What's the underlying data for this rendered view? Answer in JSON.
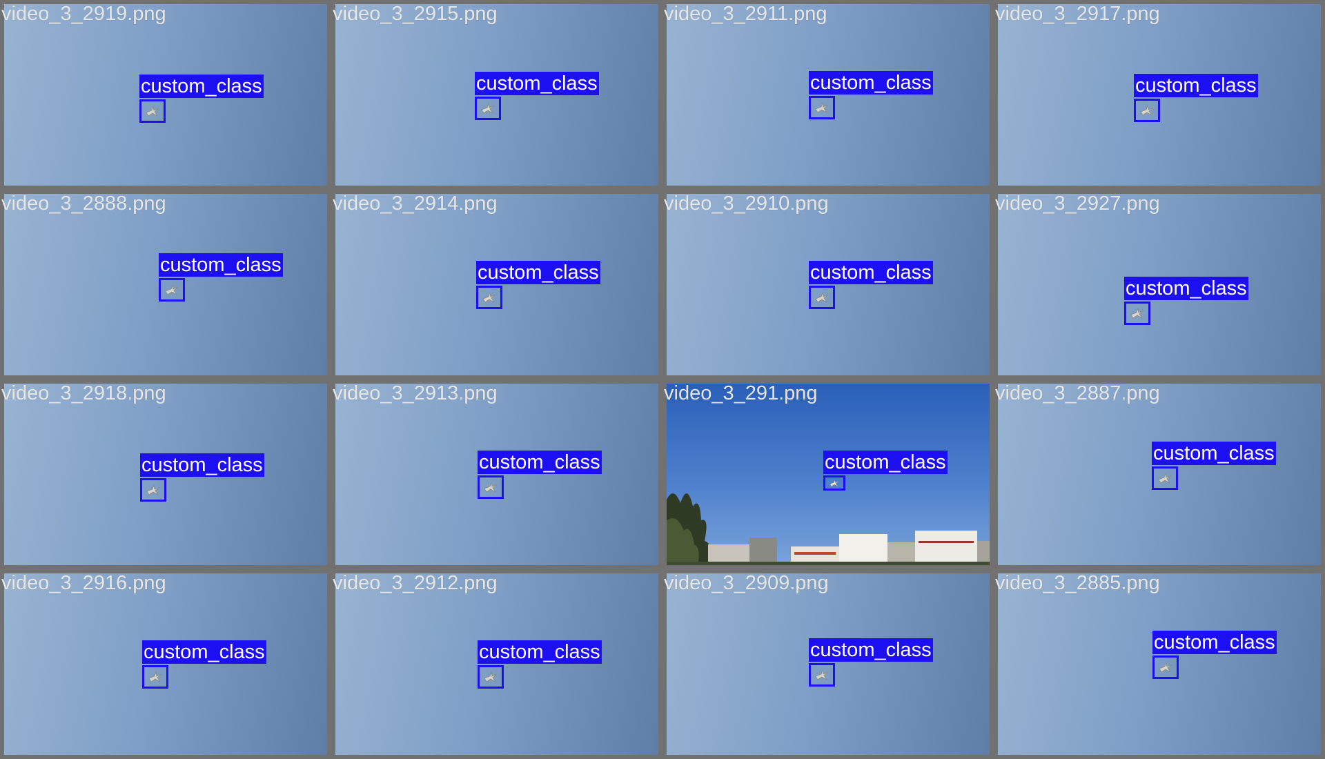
{
  "colors": {
    "tile_border": "#717171",
    "label_background": "#1c0ff2",
    "bbox_border": "#1c0ff2",
    "filename_text": "#e6e6e6",
    "label_text": "#ffffff"
  },
  "tiles": [
    {
      "filename": "video_3_2919.png",
      "label": "custom_class"
    },
    {
      "filename": "video_3_2915.png",
      "label": "custom_class"
    },
    {
      "filename": "video_3_2911.png",
      "label": "custom_class"
    },
    {
      "filename": "video_3_2917.png",
      "label": "custom_class"
    },
    {
      "filename": "video_3_2888.png",
      "label": "custom_class"
    },
    {
      "filename": "video_3_2914.png",
      "label": "custom_class"
    },
    {
      "filename": "video_3_2910.png",
      "label": "custom_class"
    },
    {
      "filename": "video_3_2927.png",
      "label": "custom_class"
    },
    {
      "filename": "video_3_2918.png",
      "label": "custom_class"
    },
    {
      "filename": "video_3_2913.png",
      "label": "custom_class"
    },
    {
      "filename": "video_3_291.png",
      "label": "custom_class"
    },
    {
      "filename": "video_3_2887.png",
      "label": "custom_class"
    },
    {
      "filename": "video_3_2916.png",
      "label": "custom_class"
    },
    {
      "filename": "video_3_2912.png",
      "label": "custom_class"
    },
    {
      "filename": "video_3_2909.png",
      "label": "custom_class"
    },
    {
      "filename": "video_3_2885.png",
      "label": "custom_class"
    }
  ]
}
